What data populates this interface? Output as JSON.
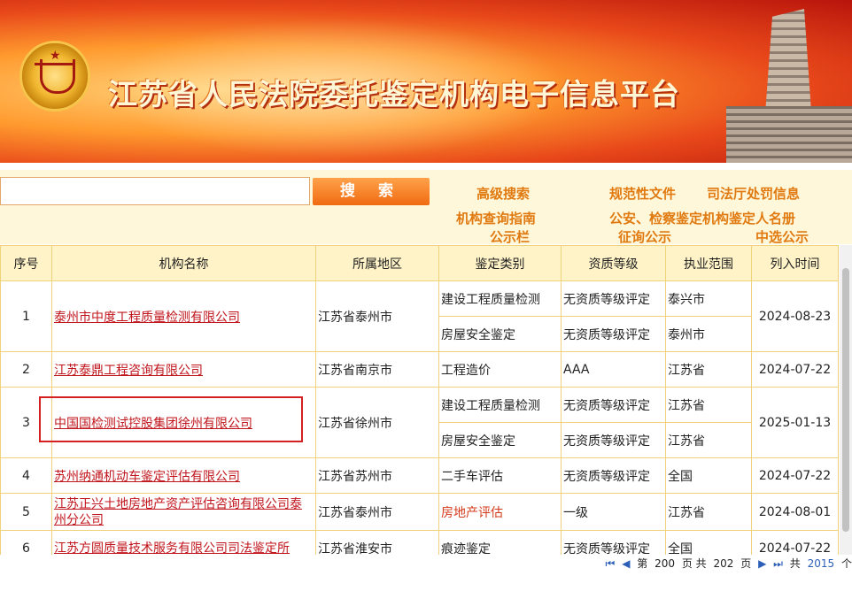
{
  "banner": {
    "title": "江苏省人民法院委托鉴定机构电子信息平台"
  },
  "search": {
    "placeholder": "",
    "button_label": "搜 索"
  },
  "quick_links": [
    {
      "label": "高级搜索"
    },
    {
      "label": "规范性文件"
    },
    {
      "label": "司法厅处罚信息"
    },
    {
      "label": "机构查询指南"
    },
    {
      "label": "公安、检察鉴定机构鉴定人名册"
    },
    {
      "label": "公示栏"
    },
    {
      "label": "征询公示"
    },
    {
      "label": "中选公示"
    }
  ],
  "table": {
    "headers": [
      "序号",
      "机构名称",
      "所属地区",
      "鉴定类别",
      "资质等级",
      "执业范围",
      "列入时间"
    ],
    "rows": [
      {
        "no": "1",
        "name": "泰州市中度工程质量检测有限公司",
        "region": "江苏省泰州市",
        "date": "2024-08-23",
        "subs": [
          {
            "category": "建设工程质量检测",
            "grade": "无资质等级评定",
            "scope": "泰兴市"
          },
          {
            "category": "房屋安全鉴定",
            "grade": "无资质等级评定",
            "scope": "泰州市"
          }
        ]
      },
      {
        "no": "2",
        "name": "江苏泰鼎工程咨询有限公司",
        "region": "江苏省南京市",
        "date": "2024-07-22",
        "subs": [
          {
            "category": "工程造价",
            "grade": "AAA",
            "scope": "江苏省"
          }
        ]
      },
      {
        "no": "3",
        "name": "中国国检测试控股集团徐州有限公司",
        "region": "江苏省徐州市",
        "date": "2025-01-13",
        "subs": [
          {
            "category": "建设工程质量检测",
            "grade": "无资质等级评定",
            "scope": "江苏省"
          },
          {
            "category": "房屋安全鉴定",
            "grade": "无资质等级评定",
            "scope": "江苏省"
          }
        ]
      },
      {
        "no": "4",
        "name": "苏州纳通机动车鉴定评估有限公司",
        "region": "江苏省苏州市",
        "date": "2024-07-22",
        "subs": [
          {
            "category": "二手车评估",
            "grade": "无资质等级评定",
            "scope": "全国"
          }
        ]
      },
      {
        "no": "5",
        "name": "江苏正兴土地房地产资产评估咨询有限公司泰州分公司",
        "region": "江苏省泰州市",
        "date": "2024-08-01",
        "subs": [
          {
            "category": "房地产评估",
            "grade": "一级",
            "scope": "江苏省"
          }
        ]
      },
      {
        "no": "6",
        "name": "江苏方圆质量技术服务有限公司司法鉴定所",
        "region": "江苏省淮安市",
        "date": "2024-07-22",
        "subs": [
          {
            "category": "痕迹鉴定",
            "grade": "无资质等级评定",
            "scope": "全国"
          }
        ]
      }
    ]
  },
  "pagination": {
    "prefix": "第",
    "current": "200",
    "page_unit": "页 共",
    "total_pages": "202",
    "suffix": "页",
    "total_label": "共",
    "total_count": "2015",
    "count_unit": "个"
  },
  "colors": {
    "accent": "#f06b12",
    "link": "#c0151c",
    "quick_link": "#e07a10",
    "table_border": "#f0d27a"
  }
}
